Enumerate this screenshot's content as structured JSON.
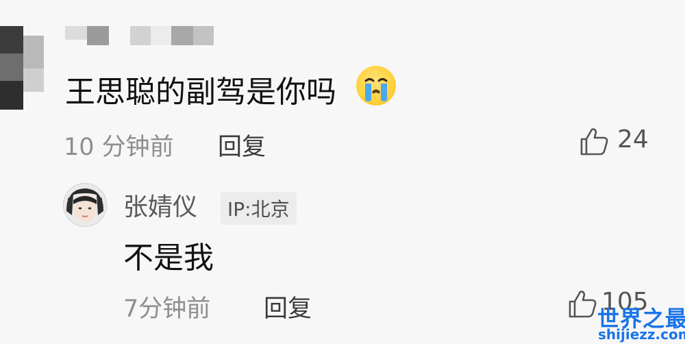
{
  "comment": {
    "text": "王思聪的副驾是你吗",
    "emoji": "loudly-crying-face",
    "time": "10 分钟前",
    "reply_label": "回复",
    "likes": "24"
  },
  "reply": {
    "username": "张婧仪",
    "ip": "IP:北京",
    "text": "不是我",
    "time": "7分钟前",
    "reply_label": "回复",
    "likes": "105"
  },
  "watermark": {
    "title": "世界之最",
    "url": "shijiezz.com"
  },
  "colors": {
    "background": "#f7f7f7",
    "meta_gray": "#8e8e8e",
    "watermark_blue": "#1a74e8"
  }
}
